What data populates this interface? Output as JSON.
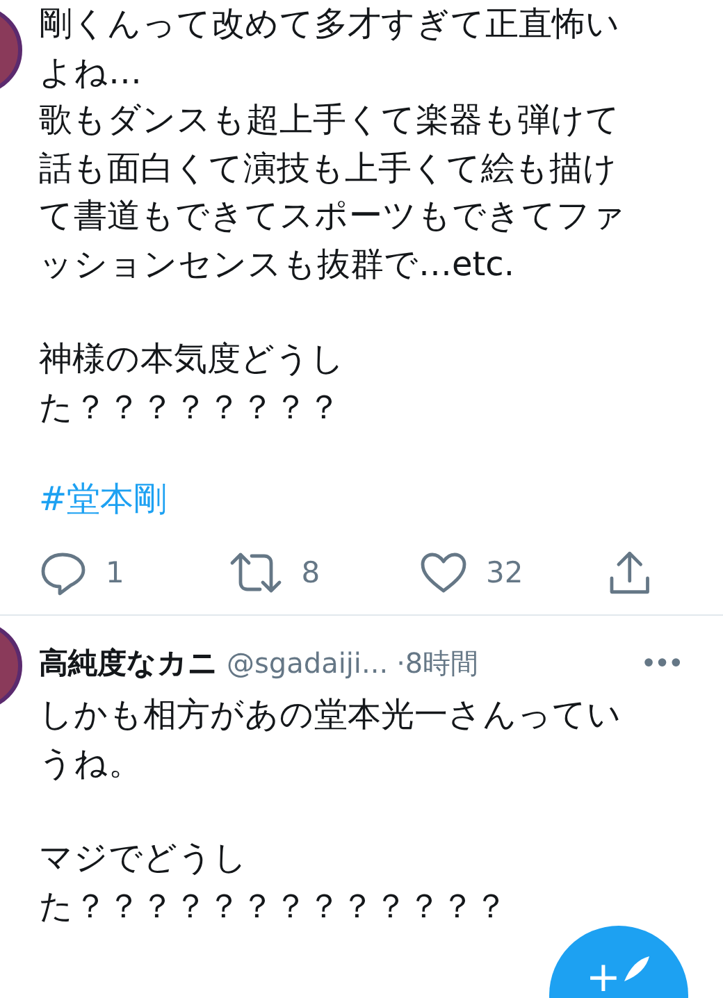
{
  "tweets": [
    {
      "body": [
        [
          "剛くんって改めて多才すぎて正直怖い",
          "よね…",
          "歌もダンスも超上手くて楽器も弾けて",
          "話も面白くて演技も上手くて絵も描け",
          "て書道もできてスポーツもできてファ",
          "ッションセンスも抜群で…etc."
        ],
        [
          "神様の本気度どうし",
          "た？？？？？？？？"
        ]
      ],
      "hashtag": "#堂本剛",
      "actions": {
        "replies": "1",
        "retweets": "8",
        "likes": "32"
      }
    },
    {
      "name": "高純度なカニ",
      "handle": "@sgadaiji...",
      "time": "·8時間",
      "more": "•••",
      "body": [
        [
          "しかも相方があの堂本光一さんってい",
          "うね。"
        ],
        [
          "マジでどうし",
          "た？？？？？？？？？？？？？"
        ]
      ]
    }
  ],
  "compose_button": {
    "label": "+"
  }
}
